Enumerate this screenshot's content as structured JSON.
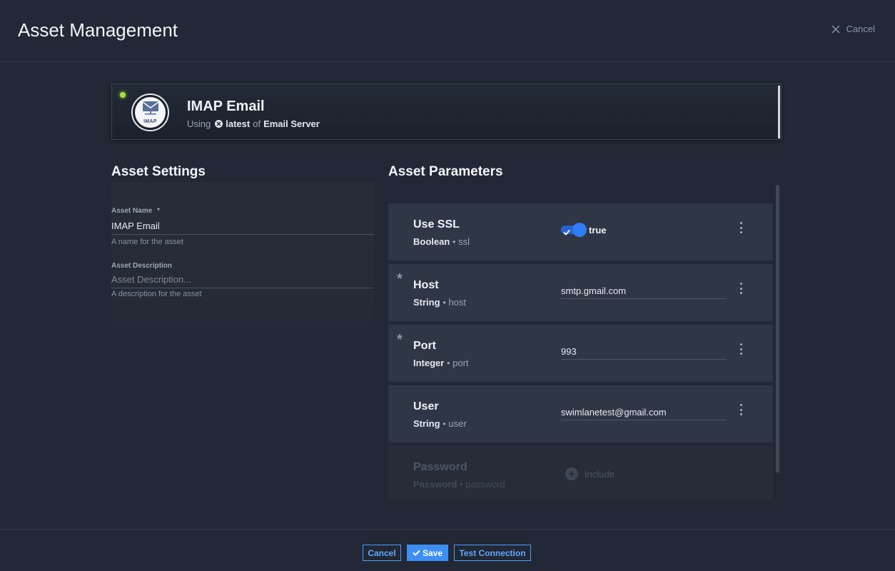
{
  "header": {
    "title": "Asset Management",
    "cancel_label": "Cancel"
  },
  "integration": {
    "name": "IMAP Email",
    "logo_text": "IMAP",
    "using_label": "Using",
    "version": "latest",
    "of_label": "of",
    "product": "Email Server",
    "status_color": "#a6e23a"
  },
  "settings": {
    "title": "Asset Settings",
    "name_label": "Asset Name",
    "name_required": "*",
    "name_value": "IMAP Email",
    "name_help": "A name for the asset",
    "description_label": "Asset Description",
    "description_placeholder": "Asset Description...",
    "description_help": "A description for the asset"
  },
  "parameters": {
    "title": "Asset Parameters",
    "items": [
      {
        "name": "Use SSL",
        "type": "Boolean",
        "key": "ssl",
        "required": "",
        "value": "true"
      },
      {
        "name": "Host",
        "type": "String",
        "key": "host",
        "required": "*",
        "value": "smtp.gmail.com"
      },
      {
        "name": "Port",
        "type": "Integer",
        "key": "port",
        "required": "*",
        "value": "993"
      },
      {
        "name": "User",
        "type": "String",
        "key": "user",
        "required": "",
        "value": "swimlanetest@gmail.com"
      },
      {
        "name": "Password",
        "type": "Password",
        "key": "password",
        "required": "",
        "value": "Include"
      }
    ]
  },
  "footer": {
    "cancel_label": "Cancel",
    "save_label": "Save",
    "test_label": "Test Connection"
  },
  "colors": {
    "background": "#222835",
    "card": "#2f3646",
    "accent": "#3d8ff5"
  }
}
